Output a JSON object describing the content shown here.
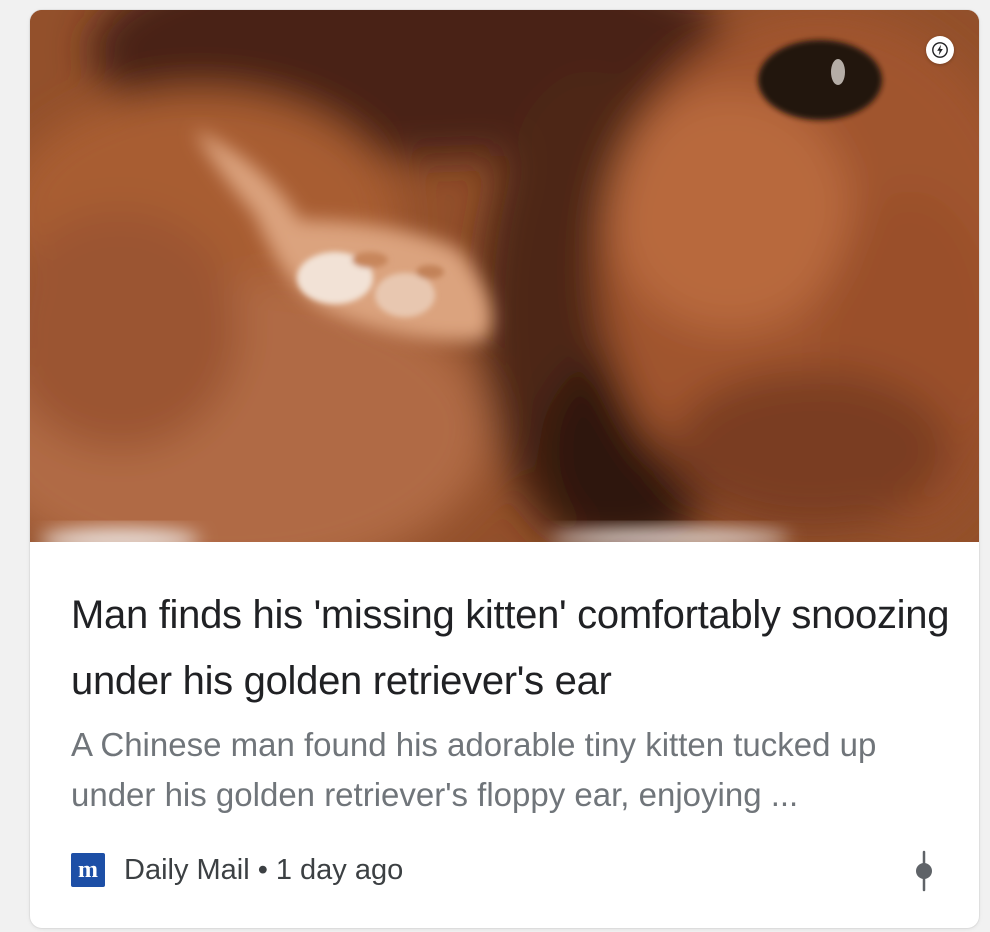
{
  "article": {
    "title": "Man finds his 'missing kitten' comfortably snoozing under his golden retriever's ear",
    "snippet": "A Chinese man found his adorable tiny kitten tucked up under his golden retriever's floppy ear, enjoying ...",
    "image_icon": "amp-lightning-icon"
  },
  "source": {
    "favicon_letter": "m",
    "name": "Daily Mail",
    "separator": "•",
    "time": "1 day ago"
  },
  "menu": {
    "icon": "more-vert-icon"
  },
  "colors": {
    "title": "#202124",
    "snippet": "#70757a",
    "favicon_bg": "#1d4fa6"
  }
}
